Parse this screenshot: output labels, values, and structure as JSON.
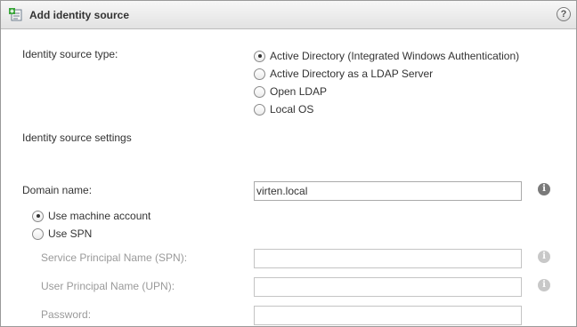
{
  "dialog": {
    "title": "Add identity source",
    "help_icon_glyph": "?"
  },
  "identity_source_type": {
    "label": "Identity source type:",
    "options": [
      {
        "label": "Active Directory (Integrated Windows Authentication)",
        "selected": true
      },
      {
        "label": "Active Directory as a LDAP Server",
        "selected": false
      },
      {
        "label": "Open LDAP",
        "selected": false
      },
      {
        "label": "Local OS",
        "selected": false
      }
    ]
  },
  "settings_heading": "Identity source settings",
  "domain": {
    "label": "Domain name:",
    "value": "virten.local",
    "info_icon": "info-icon"
  },
  "account": {
    "options": [
      {
        "label": "Use machine account",
        "selected": true
      },
      {
        "label": "Use SPN",
        "selected": false
      }
    ]
  },
  "spn": {
    "label": "Service Principal Name (SPN):",
    "value": ""
  },
  "upn": {
    "label": "User Principal Name (UPN):",
    "value": ""
  },
  "password": {
    "label": "Password:",
    "value": ""
  },
  "colors": {
    "text": "#333333",
    "disabled_text": "#9a9a9a",
    "border": "#aaaaaa",
    "titlebar_top": "#f7f7f7",
    "titlebar_bottom": "#e2e2e2"
  }
}
